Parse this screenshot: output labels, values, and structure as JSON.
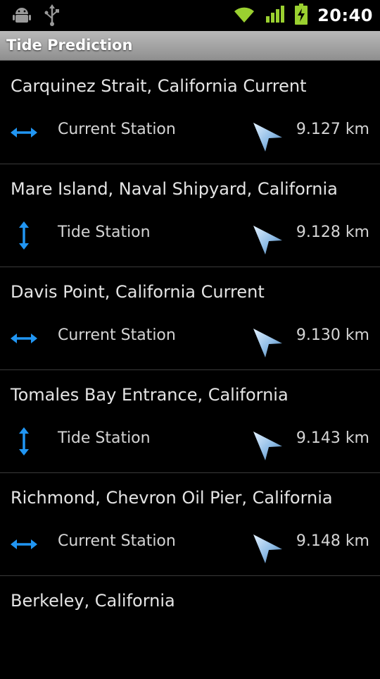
{
  "status_bar": {
    "time": "20:40",
    "icons": [
      "android-debug-icon",
      "usb-icon",
      "wifi-icon",
      "signal-icon",
      "battery-charging-icon"
    ],
    "accent_color": "#9ad030"
  },
  "title_bar": {
    "title": "Tide Prediction"
  },
  "icon_color": "#2196f3",
  "stations": [
    {
      "name": "Carquinez Strait, California Current",
      "type": "Current Station",
      "type_icon": "horizontal-arrow-icon",
      "distance": "9.127 km"
    },
    {
      "name": "Mare Island, Naval Shipyard, California",
      "type": "Tide Station",
      "type_icon": "vertical-arrow-icon",
      "distance": "9.128 km"
    },
    {
      "name": "Davis Point, California Current",
      "type": "Current Station",
      "type_icon": "horizontal-arrow-icon",
      "distance": "9.130 km"
    },
    {
      "name": "Tomales Bay Entrance, California",
      "type": "Tide Station",
      "type_icon": "vertical-arrow-icon",
      "distance": "9.143 km"
    },
    {
      "name": "Richmond, Chevron Oil Pier, California",
      "type": "Current Station",
      "type_icon": "horizontal-arrow-icon",
      "distance": "9.148 km"
    },
    {
      "name": "Berkeley, California",
      "type": "",
      "type_icon": "",
      "distance": ""
    }
  ]
}
